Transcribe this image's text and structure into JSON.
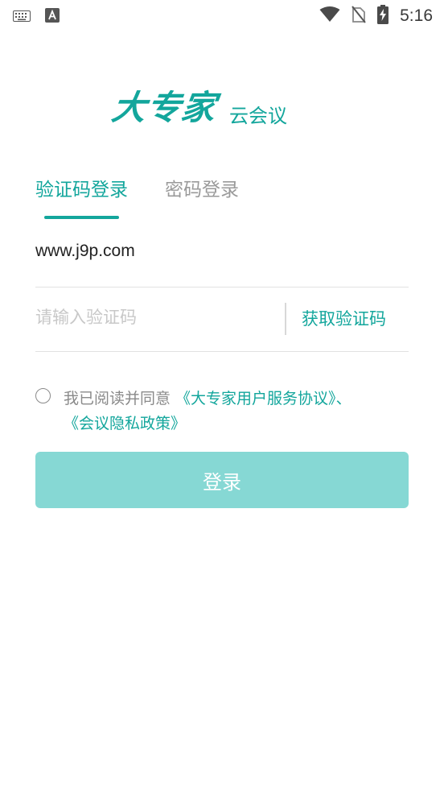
{
  "status_bar": {
    "time": "5:16",
    "icons": [
      "keyboard-icon",
      "text-a-icon",
      "wifi-icon",
      "no-sim-icon",
      "battery-charging-icon"
    ]
  },
  "logo": {
    "brand": "大专家",
    "subtitle": "云会议"
  },
  "tabs": [
    {
      "label": "验证码登录",
      "active": true
    },
    {
      "label": "密码登录",
      "active": false
    }
  ],
  "phone_field": {
    "value": "www.j9p.com"
  },
  "code_field": {
    "placeholder": "请输入验证码",
    "get_code_label": "获取验证码"
  },
  "agreement": {
    "prefix": "我已阅读并同意 ",
    "link1": "《大专家用户服务协议》",
    "separator": "、",
    "link2": "《会议隐私政策》"
  },
  "login_button": {
    "label": "登录"
  },
  "colors": {
    "accent": "#13a69c",
    "button_disabled": "#86d8d4",
    "muted_text": "#8a8a8a",
    "placeholder": "#c8c8c8"
  }
}
